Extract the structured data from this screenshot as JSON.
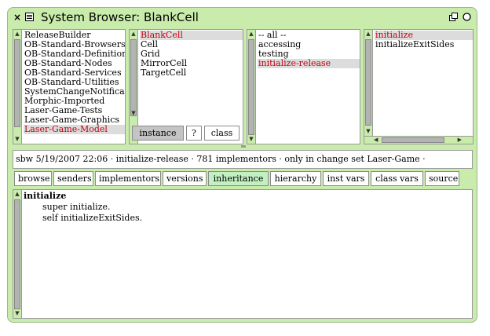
{
  "window": {
    "title": "System Browser: BlankCell",
    "close_icon": "×",
    "menu_icon": "≡"
  },
  "categories": {
    "items": [
      "ReleaseBuilder",
      "OB-Standard-Browsers",
      "OB-Standard-Definition",
      "OB-Standard-Nodes",
      "OB-Standard-Services",
      "OB-Standard-Utilities",
      "SystemChangeNotificat",
      "Morphic-Imported",
      "Laser-Game-Tests",
      "Laser-Game-Graphics",
      "Laser-Game-Model"
    ],
    "selected": "Laser-Game-Model"
  },
  "classes": {
    "items": [
      "BlankCell",
      "Cell",
      "Grid",
      "MirrorCell",
      "TargetCell"
    ],
    "selected": "BlankCell",
    "instance_label": "instance",
    "help_label": "?",
    "class_label": "class"
  },
  "protocols": {
    "items": [
      "-- all --",
      "accessing",
      "testing",
      "initialize-release"
    ],
    "selected": "initialize-release"
  },
  "methods": {
    "items": [
      "initialize",
      "initializeExitSides"
    ],
    "selected": "initialize"
  },
  "status": {
    "text": "sbw 5/19/2007 22:06 · initialize-release · 781 implementors · only in change set Laser-Game  ·"
  },
  "toolbar": {
    "browse": "browse",
    "senders": "senders",
    "implementors": "implementors",
    "versions": "versions",
    "inheritance": "inheritance",
    "hierarchy": "hierarchy",
    "inst_vars": "inst vars",
    "class_vars": "class vars",
    "source": "source"
  },
  "code": {
    "line1": "initialize",
    "line2": "super initialize.",
    "line3": "self initializeExitSides."
  },
  "colors": {
    "window_bg": "#c9ecac",
    "selected_text": "#c0000e",
    "inheritance_button": "#c2f0c2"
  }
}
